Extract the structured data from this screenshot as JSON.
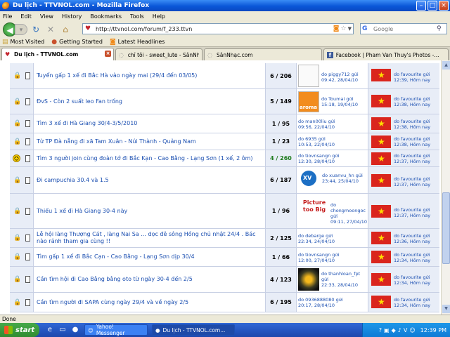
{
  "window": {
    "title": "Du lịch - TTVNOL.com - Mozilla Firefox"
  },
  "menu": [
    "File",
    "Edit",
    "View",
    "History",
    "Bookmarks",
    "Tools",
    "Help"
  ],
  "address": {
    "url": "http://ttvnol.com/forum/f_233.ttvn"
  },
  "search": {
    "placeholder": "Google"
  },
  "bookmarks": [
    "Most Visited",
    "Getting Started",
    "Latest Headlines"
  ],
  "tabs": [
    {
      "label": "Du lịch - TTVNOL.com",
      "active": true
    },
    {
      "label": "chỉ tôi - sweet_lute - SânNhạc.com",
      "active": false
    },
    {
      "label": "SânNhạc.com",
      "active": false
    },
    {
      "label": "Facebook | Pham Van Thuy's Photos -...",
      "active": false
    }
  ],
  "threads": [
    {
      "title": "Tuyển gấp 1 xế đi Bắc Hà vào ngày mai (29/4 đến 03/05)",
      "stats": "6 / 206",
      "poster": "do piggy712 gửi",
      "poster_time": "09:42, 28/04/10",
      "avatar": "blank",
      "last_by": "do favourite gửi",
      "last_time": "12:39, Hôm nay"
    },
    {
      "title": "ĐvS - Còn 2 suất leo Fan trống",
      "stats": "5 / 149",
      "poster": "do Toumai gửi",
      "poster_time": "15:18, 19/04/10",
      "avatar": "aroma",
      "avatar_text": "aroma",
      "last_by": "do favourite gửi",
      "last_time": "12:38, Hôm nay"
    },
    {
      "title": "Tìm 3 xế đi Hà Giang 30/4-3/5/2010",
      "stats": "1 / 95",
      "poster": "do man00liu gửi",
      "poster_time": "09:56, 22/04/10",
      "avatar": "none",
      "last_by": "do favourite gửi",
      "last_time": "12:38, Hôm nay"
    },
    {
      "title": "Từ TP Đà nẵng đi xã Tam Xuân - Núi Thành - Quảng Nam",
      "stats": "1 / 23",
      "poster": "do 6935 gửi",
      "poster_time": "10:53, 22/04/10",
      "avatar": "none",
      "last_by": "do favourite gửi",
      "last_time": "12:38, Hôm nay"
    },
    {
      "title": "Tìm 3 người join cùng đoàn tớ đi Bắc Kạn - Cao Bằng - Lạng Sơn (1 xế, 2 ôm)",
      "stats": "4 / 260",
      "hot": true,
      "poster": "do tiovnsangn gửi",
      "poster_time": "12:30, 28/04/10",
      "avatar": "none",
      "smiley": true,
      "last_by": "do favourite gửi",
      "last_time": "12:37, Hôm nay"
    },
    {
      "title": "Đi campuchia 30.4 và 1.5",
      "stats": "6 / 187",
      "poster": "do xuanvu_hn gửi",
      "poster_time": "23:44, 25/04/10",
      "avatar": "xv",
      "avatar_text": "XV",
      "last_by": "do favourite gửi",
      "last_time": "12:37, Hôm nay"
    },
    {
      "title": "Thiếu 1 xế đi Hà Giang 30-4 này",
      "stats": "1 / 96",
      "poster": "do chongmoongoc gửi",
      "poster_time": "09:11, 27/04/10",
      "avatar": "picture",
      "avatar_text": "Picture too Big",
      "last_by": "do favourite gửi",
      "last_time": "12:37, Hôm nay"
    },
    {
      "title": "Lễ hội làng Thượng Cát , làng Nai Sa ... dọc đê sông Hồng chủ nhật 24/4 . Bác nào rảnh tham gia cùng !!",
      "stats": "2 / 125",
      "poster": "do debarge gửi",
      "poster_time": "22:34, 24/04/10",
      "avatar": "none",
      "last_by": "do favourite gửi",
      "last_time": "12:36, Hôm nay"
    },
    {
      "title": "Tìm gấp 1 xế đi Bắc Cạn - Cao Bằng - Lạng Sơn dịp 30/4",
      "stats": "1 / 66",
      "poster": "do tiovnsangn gửi",
      "poster_time": "12:00, 27/04/10",
      "avatar": "none",
      "last_by": "do favourite gửi",
      "last_time": "12:34, Hôm nay"
    },
    {
      "title": "Cần tìm hội đi Cao Bằng bằng oto từ ngày 30-4 đến 2/5",
      "stats": "4 / 123",
      "poster": "do thanhloan_fpt gửi",
      "poster_time": "22:33, 28/04/10",
      "avatar": "sun",
      "last_by": "do favourite gửi",
      "last_time": "12:34, Hôm nay"
    },
    {
      "title": "Cần tìm người đi SAPA cùng ngày 29/4 và về ngày 2/5",
      "stats": "6 / 195",
      "poster": "do 0936888080 gửi",
      "poster_time": "20:17, 28/04/10",
      "avatar": "none",
      "last_by": "do favourite gửi",
      "last_time": "12:34, Hôm nay"
    }
  ],
  "status": {
    "text": "Done"
  },
  "taskbar": {
    "start": "start",
    "items": [
      {
        "label": "Yahoo! Messenger",
        "active": false
      },
      {
        "label": "Du lịch - TTVNOL.com...",
        "active": true
      }
    ],
    "clock": "12:39 PM"
  }
}
